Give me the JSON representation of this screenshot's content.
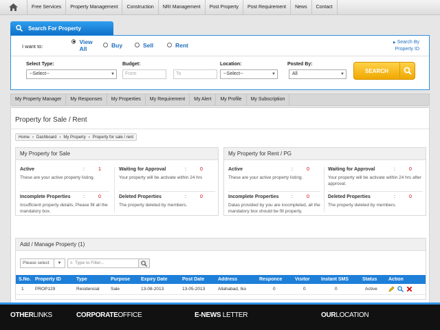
{
  "topnav": {
    "items": [
      "Free Services",
      "Property Management",
      "Construction",
      "NRI Management",
      "Post Property",
      "Post Requirement",
      "News",
      "Contact"
    ]
  },
  "search": {
    "tab_title": "Search For Property",
    "want_label": "I want to:",
    "options": [
      "View All",
      "Buy",
      "Sell",
      "Rent"
    ],
    "selected": "View All",
    "id_link": "Search By Property ID",
    "select_type_label": "Select Type:",
    "select_type_value": "--Select--",
    "budget_label": "Budget:",
    "budget_from": "From",
    "budget_to": "To",
    "location_label": "Location:",
    "location_value": "--Select--",
    "posted_by_label": "Posted By:",
    "posted_by_value": "All",
    "button": "SEARCH"
  },
  "subnav": {
    "items": [
      "My Property Manager",
      "My Responses",
      "My Properties",
      "My Requirement",
      "My Alert",
      "My Profile",
      "My Subscription"
    ]
  },
  "page": {
    "title": "Property for Sale / Rent",
    "breadcrumb": [
      "Home",
      "Dashboard",
      "My Property",
      "Property for sale / rent"
    ]
  },
  "sale": {
    "title": "My Property for Sale",
    "active": {
      "title": "Active",
      "count": "1",
      "desc": "These are your active property listing."
    },
    "waiting": {
      "title": "Waiting for Approval",
      "count": "0",
      "desc": "Your property will be activate within 24 hrs"
    },
    "incomplete": {
      "title": "Incomplete Properties",
      "count": "0",
      "desc": "Insufficient property details, Please fill all the mandatory box."
    },
    "deleted": {
      "title": "Deleted Properties",
      "count": "0",
      "desc": "The property deleted by members."
    }
  },
  "rent": {
    "title": "My Property for Rent / PG",
    "active": {
      "title": "Active",
      "count": "0",
      "desc": "These are your active property listing."
    },
    "waiting": {
      "title": "Waiting for Approval",
      "count": "0",
      "desc": "Your property will be activate within 24 hrs after approval."
    },
    "incomplete": {
      "title": "Incomplete Properties",
      "count": "0",
      "desc": "Datas provided by you are incompleted, all the mandatory box should be fill properly."
    },
    "deleted": {
      "title": "Deleted Properties",
      "count": "0",
      "desc": "The property deleted by members."
    }
  },
  "colon": ":",
  "manage": {
    "title": "Add / Manage Property (1)",
    "filter_select": "Please select",
    "filter_placeholder": "Type to Filter...",
    "columns": [
      "S.No.",
      "Property ID",
      "Type",
      "Purpose",
      "Expiry Date",
      "Post Date",
      "Address",
      "Responce",
      "Visitor",
      "Instant SMS",
      "Status",
      "Action"
    ],
    "rows": [
      [
        "1",
        "PROP129",
        "Residencial",
        "Sale",
        "13-08-2013",
        "13-05-2013",
        "Allahabad, Iko",
        "0",
        "0",
        "0",
        "Active"
      ]
    ]
  },
  "footer": {
    "other": [
      "OTHER",
      "LINKS"
    ],
    "corporate": [
      "CORPORATE",
      "OFFICE"
    ],
    "enews": [
      "E-NEWS",
      "LETTER"
    ],
    "location": [
      "OUR",
      "LOCATION"
    ]
  }
}
